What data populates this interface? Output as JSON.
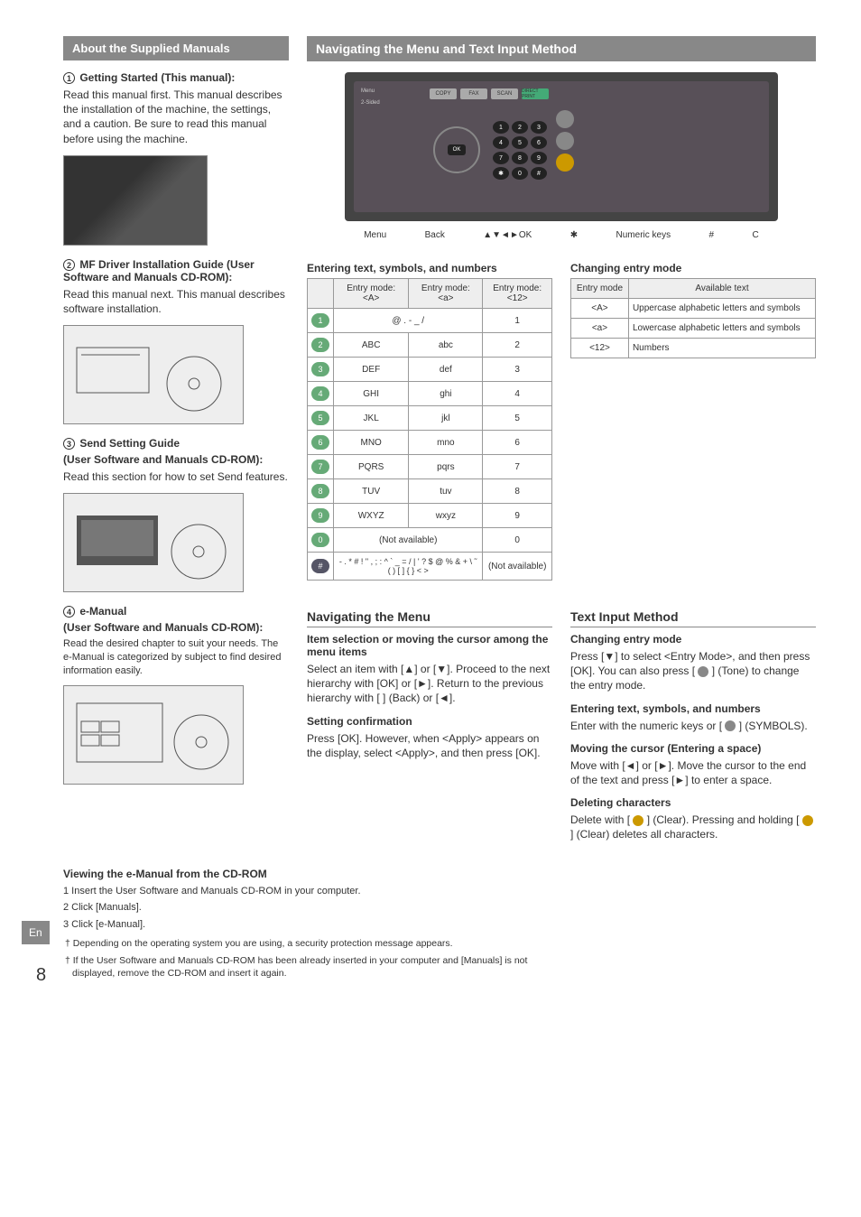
{
  "page_number": "8",
  "lang_tab": "En",
  "left": {
    "banner": "About the Supplied Manuals",
    "m1_title": "Getting Started (This manual):",
    "m1_body": "Read this manual first. This manual describes the installation of the machine, the settings, and a caution. Be sure to read this manual before using the machine.",
    "m2_title": "MF Driver Installation Guide (User Software and Manuals CD-ROM):",
    "m2_body": "Read this manual next. This manual describes software installation.",
    "m3_title": "Send Setting Guide",
    "m3_sub": "(User Software and Manuals CD-ROM):",
    "m3_body": "Read this section for how to set Send features.",
    "m4_title": "e-Manual",
    "m4_sub": "(User Software and Manuals CD-ROM):",
    "m4_body": "Read the desired chapter to suit your needs. The e-Manual is categorized by subject to find desired information easily."
  },
  "right": {
    "banner": "Navigating the Menu and Text Input Method",
    "panel_labels": [
      "Menu",
      "Back",
      "▲▼◄►OK",
      "✱",
      "Numeric keys",
      "#",
      "C"
    ],
    "entering_h": "Entering text, symbols, and numbers",
    "entry_table": {
      "headers": [
        "",
        "Entry mode: <A>",
        "Entry mode: <a>",
        "Entry mode: <12>"
      ],
      "rows": [
        {
          "key": "1",
          "a": "@ . - _ /",
          "b": "@ . - _ /",
          "n": "1",
          "merge_ab": true
        },
        {
          "key": "2",
          "a": "ABC",
          "b": "abc",
          "n": "2"
        },
        {
          "key": "3",
          "a": "DEF",
          "b": "def",
          "n": "3"
        },
        {
          "key": "4",
          "a": "GHI",
          "b": "ghi",
          "n": "4"
        },
        {
          "key": "5",
          "a": "JKL",
          "b": "jkl",
          "n": "5"
        },
        {
          "key": "6",
          "a": "MNO",
          "b": "mno",
          "n": "6"
        },
        {
          "key": "7",
          "a": "PQRS",
          "b": "pqrs",
          "n": "7"
        },
        {
          "key": "8",
          "a": "TUV",
          "b": "tuv",
          "n": "8"
        },
        {
          "key": "9",
          "a": "WXYZ",
          "b": "wxyz",
          "n": "9"
        },
        {
          "key": "0",
          "a": "(Not available)",
          "b": "",
          "n": "0",
          "merge_ab": true
        },
        {
          "key": "#",
          "a": "- . * # ! \" , ; : ^ ` _ = / | ' ? $ @ % & + \\ ˜ ( ) [ ] { } < >",
          "b": "",
          "n": "(Not available)",
          "merge_ab": true
        }
      ]
    },
    "changing_h": "Changing entry mode",
    "mode_table": {
      "headers": [
        "Entry mode",
        "Available text"
      ],
      "rows": [
        {
          "m": "<A>",
          "t": "Uppercase alphabetic letters and symbols"
        },
        {
          "m": "<a>",
          "t": "Lowercase alphabetic letters and symbols"
        },
        {
          "m": "<12>",
          "t": "Numbers"
        }
      ]
    },
    "nav_h": "Navigating the Menu",
    "nav_item_h": "Item selection or moving the cursor among the menu items",
    "nav_item_body": "Select an item with [▲] or [▼]. Proceed to the next hierarchy with [OK] or [►]. Return to the previous hierarchy with [     ] (Back) or [◄].",
    "setting_h": "Setting confirmation",
    "setting_body": "Press [OK]. However, when <Apply> appears on the display, select <Apply>, and then press [OK].",
    "text_h": "Text Input Method",
    "t_change_h": "Changing entry mode",
    "t_change_body": "Press [▼] to select <Entry Mode>, and then press [OK]. You can also press [     ] (Tone) to change the entry mode.",
    "t_enter_h": "Entering text, symbols, and numbers",
    "t_enter_body": "Enter with the numeric keys or [     ] (SYMBOLS).",
    "t_move_h": "Moving the cursor (Entering a space)",
    "t_move_body": "Move with [◄] or [►]. Move the cursor to the end of the text and press [►] to enter a space.",
    "t_del_h": "Deleting characters",
    "t_del_body": "Delete with [     ] (Clear). Pressing and holding [     ] (Clear) deletes all characters."
  },
  "bottom": {
    "view_h": "Viewing the e-Manual from the CD-ROM",
    "steps": [
      "1 Insert the User Software and Manuals CD-ROM in your computer.",
      "2 Click [Manuals].",
      "3 Click [e-Manual]."
    ],
    "note1": "† Depending on the operating system you are using, a security protection message appears.",
    "note2": "† If the User Software and Manuals CD-ROM has been already inserted in your computer and [Manuals] is not displayed, remove the CD-ROM and insert it again."
  }
}
